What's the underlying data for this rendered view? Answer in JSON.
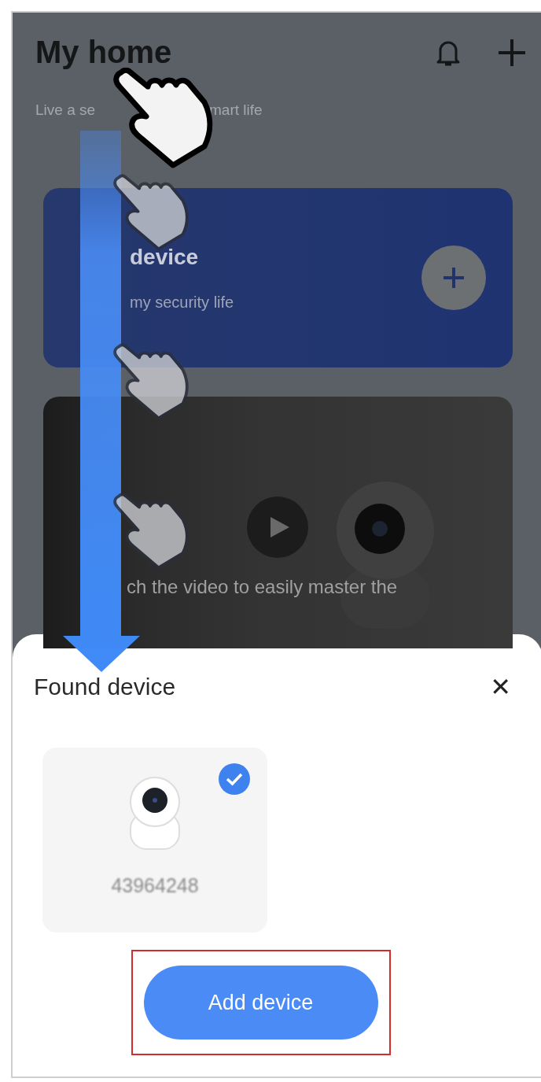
{
  "header": {
    "title": "My home",
    "subtitle_parts": [
      "Live a se",
      "mart life"
    ]
  },
  "add_card": {
    "title": "device",
    "subtitle": "my security life"
  },
  "video_card": {
    "caption": "ch the video to easily master the"
  },
  "sheet": {
    "title": "Found device",
    "close": "✕",
    "button": "Add device",
    "devices": [
      {
        "name": "43964248",
        "selected": true
      }
    ]
  }
}
